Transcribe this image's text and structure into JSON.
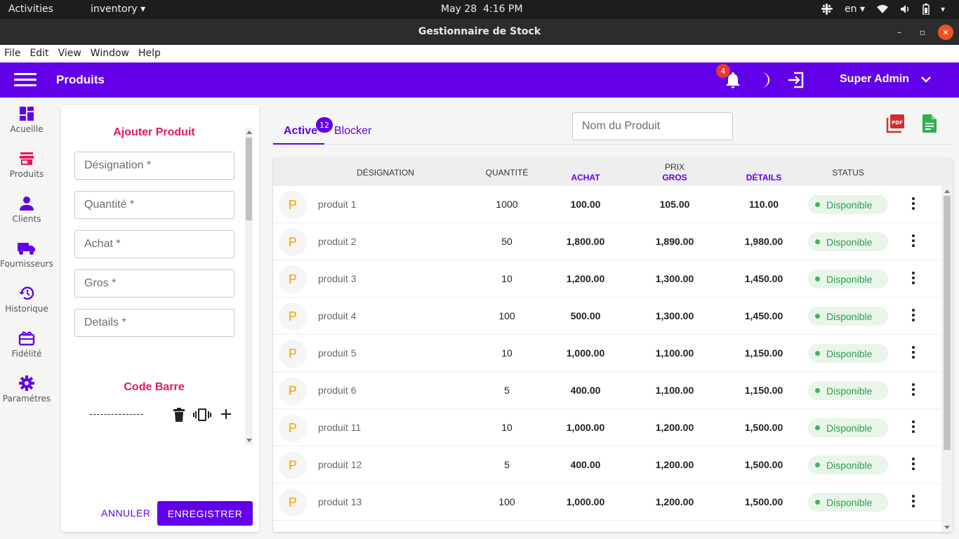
{
  "system": {
    "activities": "Activities",
    "app_menu": "inventory",
    "date": "May 28",
    "time": "4:16 PM",
    "language": "en"
  },
  "window": {
    "title": "Gestionnaire de Stock",
    "minimize": "–",
    "maximize": "▫",
    "close": "✕"
  },
  "menu": [
    "File",
    "Edit",
    "View",
    "Window",
    "Help"
  ],
  "header": {
    "title": "Produits",
    "notification_count": "4",
    "user": "Super Admin"
  },
  "sidebar": {
    "items": [
      {
        "label": "Acueille",
        "icon": "dashboard-icon"
      },
      {
        "label": "Produits",
        "icon": "store-icon"
      },
      {
        "label": "Clients",
        "icon": "person-icon"
      },
      {
        "label": "Fournisseurs",
        "icon": "truck-icon"
      },
      {
        "label": "Historique",
        "icon": "history-icon"
      },
      {
        "label": "Fidélité",
        "icon": "gift-card-icon"
      },
      {
        "label": "Paramétres",
        "icon": "gear-icon"
      }
    ]
  },
  "form": {
    "title": "Ajouter Produit",
    "fields": [
      {
        "placeholder": "Désignation *"
      },
      {
        "placeholder": "Quantité *"
      },
      {
        "placeholder": "Achat *"
      },
      {
        "placeholder": "Gros *"
      },
      {
        "placeholder": "Details *"
      }
    ],
    "barcode_title": "Code Barre",
    "barcode_value": "---------------",
    "cancel": "ANNULER",
    "save": "ENREGISTRER"
  },
  "tabs": {
    "active": "Active",
    "active_count": "12",
    "blocked": "Blocker"
  },
  "search": {
    "placeholder": "Nom du Produit"
  },
  "table": {
    "headers": {
      "designation": "DÉSIGNATION",
      "quantite": "QUANTITÉ",
      "prix": "PRIX",
      "achat": "ACHAT",
      "gros": "GROS",
      "details": "DÉTAILS",
      "status": "STATUS"
    },
    "rows": [
      {
        "avatar": "P",
        "name": "produit 1",
        "qty": "1000",
        "achat": "100.00",
        "gros": "105.00",
        "details": "110.00",
        "status": "Disponible"
      },
      {
        "avatar": "P",
        "name": "produit 2",
        "qty": "50",
        "achat": "1,800.00",
        "gros": "1,890.00",
        "details": "1,980.00",
        "status": "Disponible"
      },
      {
        "avatar": "P",
        "name": "produit 3",
        "qty": "10",
        "achat": "1,200.00",
        "gros": "1,300.00",
        "details": "1,450.00",
        "status": "Disponible"
      },
      {
        "avatar": "P",
        "name": "produit 4",
        "qty": "100",
        "achat": "500.00",
        "gros": "1,300.00",
        "details": "1,450.00",
        "status": "Disponible"
      },
      {
        "avatar": "P",
        "name": "produit 5",
        "qty": "10",
        "achat": "1,000.00",
        "gros": "1,100.00",
        "details": "1,150.00",
        "status": "Disponible"
      },
      {
        "avatar": "P",
        "name": "produit 6",
        "qty": "5",
        "achat": "400.00",
        "gros": "1,100.00",
        "details": "1,150.00",
        "status": "Disponible"
      },
      {
        "avatar": "P",
        "name": "produit 11",
        "qty": "10",
        "achat": "1,000.00",
        "gros": "1,200.00",
        "details": "1,500.00",
        "status": "Disponible"
      },
      {
        "avatar": "P",
        "name": "produit 12",
        "qty": "5",
        "achat": "400.00",
        "gros": "1,200.00",
        "details": "1,500.00",
        "status": "Disponible"
      },
      {
        "avatar": "P",
        "name": "produit 13",
        "qty": "100",
        "achat": "1,000.00",
        "gros": "1,200.00",
        "details": "1,500.00",
        "status": "Disponible"
      }
    ]
  },
  "colors": {
    "primary": "#6200ea",
    "accent": "#e5195a",
    "status_bg": "#e8f5e9",
    "status_text": "#2e9d4d",
    "pdf": "#d32f2f",
    "excel": "#2fb24a"
  }
}
